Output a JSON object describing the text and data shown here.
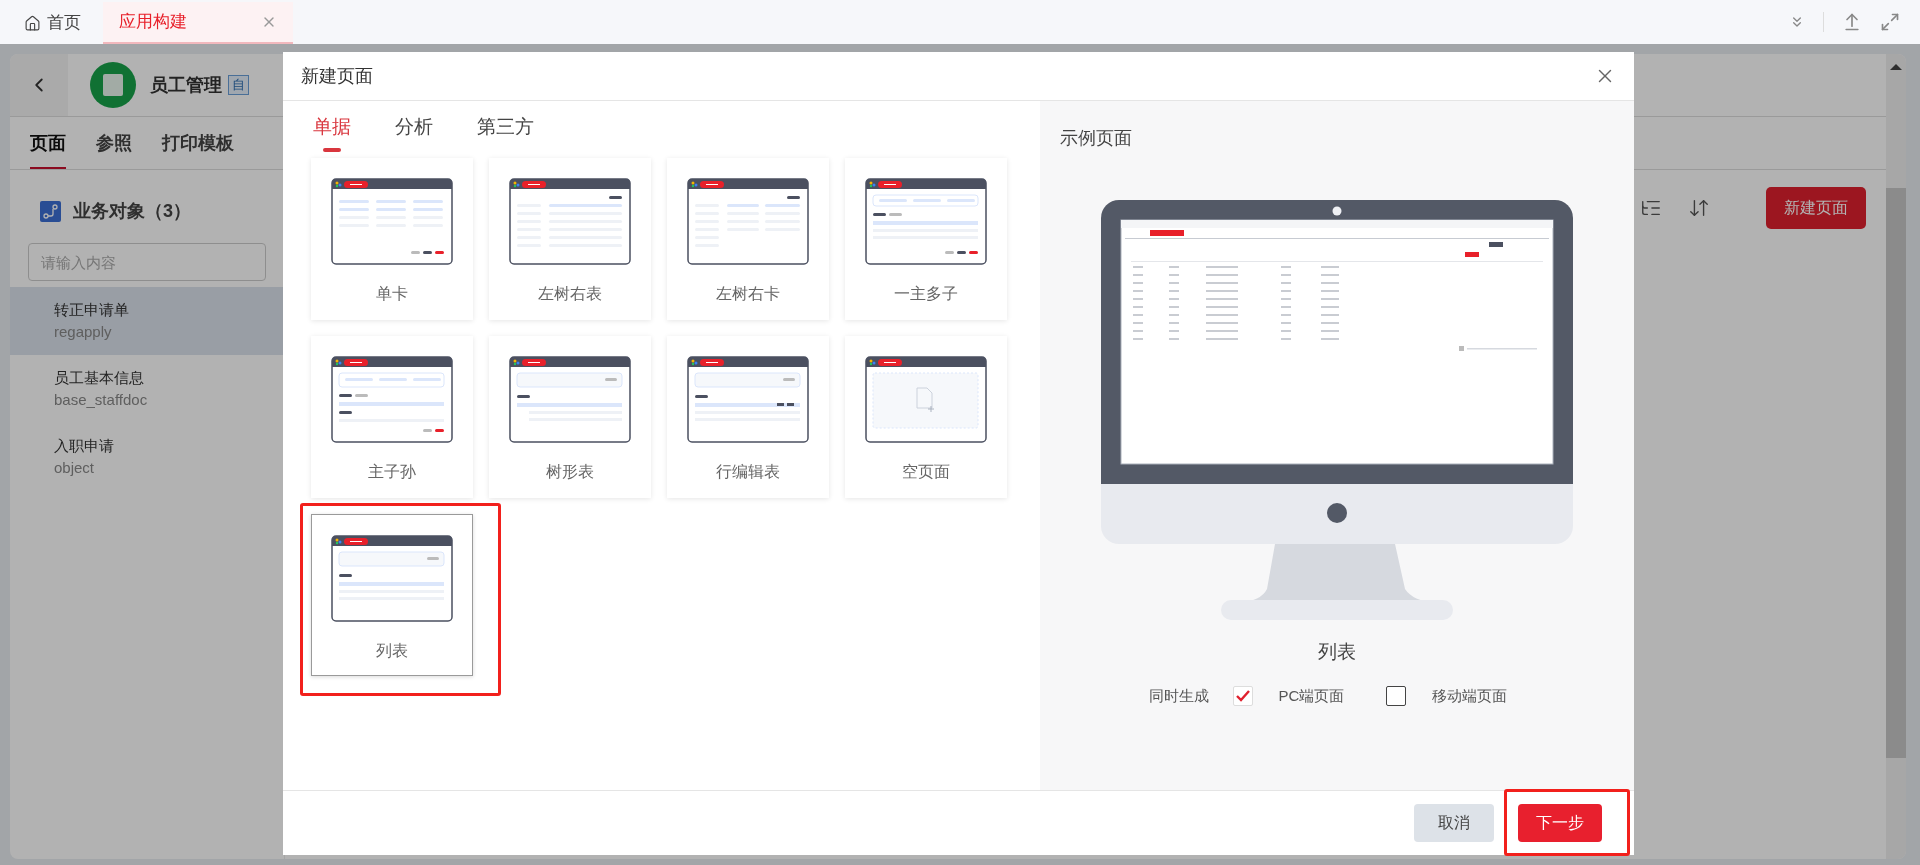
{
  "tabs": [
    {
      "label": "首页",
      "selected": false,
      "closable": false
    },
    {
      "label": "应用构建",
      "selected": true,
      "closable": true
    }
  ],
  "app": {
    "title": "员工管理",
    "badge": "自",
    "tabs": [
      {
        "label": "页面",
        "selected": true
      },
      {
        "label": "参照",
        "selected": false
      },
      {
        "label": "打印模板",
        "selected": false
      }
    ],
    "section_title": "业务对象（3）",
    "search": {
      "placeholder": "请输入内容"
    },
    "objects": [
      {
        "name": "转正申请单",
        "code": "regapply",
        "selected": true
      },
      {
        "name": "员工基本信息",
        "code": "base_staffdoc",
        "selected": false
      },
      {
        "name": "入职申请",
        "code": "object",
        "selected": false
      }
    ],
    "new_page_button": "新建页面"
  },
  "dialog": {
    "title": "新建页面",
    "tabs": [
      {
        "label": "单据",
        "selected": true
      },
      {
        "label": "分析",
        "selected": false
      },
      {
        "label": "第三方",
        "selected": false
      }
    ],
    "templates": [
      {
        "label": "单卡",
        "kind": "card",
        "selected": false
      },
      {
        "label": "左树右表",
        "kind": "tree-table",
        "selected": false
      },
      {
        "label": "左树右卡",
        "kind": "tree-card",
        "selected": false
      },
      {
        "label": "一主多子",
        "kind": "master-detail",
        "selected": false
      },
      {
        "label": "主子孙",
        "kind": "three-level",
        "selected": false
      },
      {
        "label": "树形表",
        "kind": "tree",
        "selected": false
      },
      {
        "label": "行编辑表",
        "kind": "row-edit",
        "selected": false
      },
      {
        "label": "空页面",
        "kind": "blank",
        "selected": false
      },
      {
        "label": "列表",
        "kind": "list",
        "selected": true
      }
    ],
    "preview": {
      "title": "示例页面",
      "template_name": "列表",
      "generate_label": "同时生成",
      "options": [
        {
          "label": "PC端页面",
          "checked": true
        },
        {
          "label": "移动端页面",
          "checked": false
        }
      ]
    },
    "buttons": [
      {
        "label": "取消",
        "kind": "secondary",
        "highlighted": false
      },
      {
        "label": "下一步",
        "kind": "primary",
        "highlighted": true
      }
    ]
  }
}
